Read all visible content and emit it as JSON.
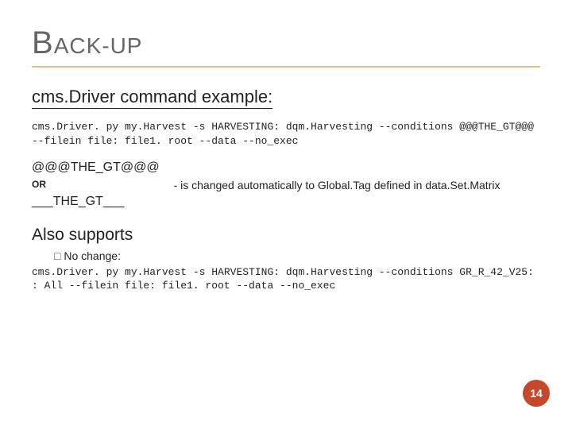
{
  "title": "BACK-UP",
  "section1_heading": "cms.Driver command example:",
  "command_example": "cms.Driver. py my.Harvest -s HARVESTING: dqm.Harvesting --conditions @@@THE_GT@@@ --filein file: file1. root --data --no_exec",
  "gt1": "@@@THE_GT@@@",
  "or_label": "OR",
  "gt2": "___THE_GT___",
  "gt_note": "- is changed automatically to Global.Tag defined in data.Set.Matrix",
  "also_heading": "Also supports",
  "also_bullet": "No change:",
  "command_supports": "cms.Driver. py my.Harvest -s HARVESTING: dqm.Harvesting --conditions GR_R_42_V25: : All --filein file: file1. root --data --no_exec",
  "page_number": "14"
}
